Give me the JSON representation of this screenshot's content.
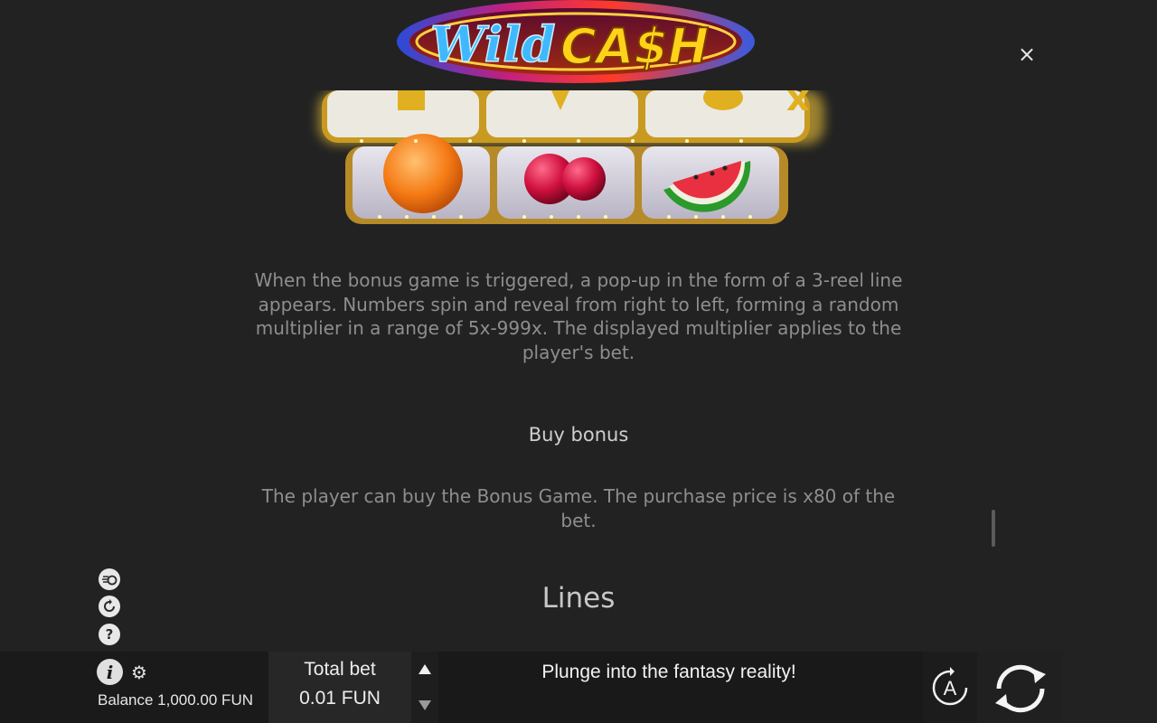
{
  "logo": {
    "word1": "Wild",
    "word2": "CA$H"
  },
  "close_icon": "×",
  "rules": {
    "bonus_description": "When the bonus game is triggered, a pop-up in the form of a 3-reel line appears. Numbers spin and reveal from right to left, forming a random multiplier in a range of 5x-999x. The displayed multiplier applies to the player's bet.",
    "buy_bonus_title": "Buy bonus",
    "buy_bonus_description": "The player can buy the Bonus Game. The purchase price is x80 of the bet.",
    "lines_title": "Lines"
  },
  "reel_symbols": [
    "orange",
    "cherries",
    "watermelon"
  ],
  "side_icons": {
    "turbo": "turbo-icon",
    "autoplay_history": "refresh-icon",
    "help": "?"
  },
  "bottom_bar": {
    "info": "i",
    "settings": "gear-icon",
    "balance": "Balance 1,000.00 FUN",
    "total_bet_label": "Total bet",
    "total_bet_value": "0.01 FUN",
    "message": "Plunge into the fantasy reality!",
    "auto_label": "A"
  },
  "colors": {
    "background": "#222222",
    "body_text": "#8e8e8e",
    "heading_text": "#cfcfcf",
    "logo_wild": "#3fb8ff",
    "logo_cash": "#ffd21a",
    "logo_dollar": "#3ad43a"
  }
}
